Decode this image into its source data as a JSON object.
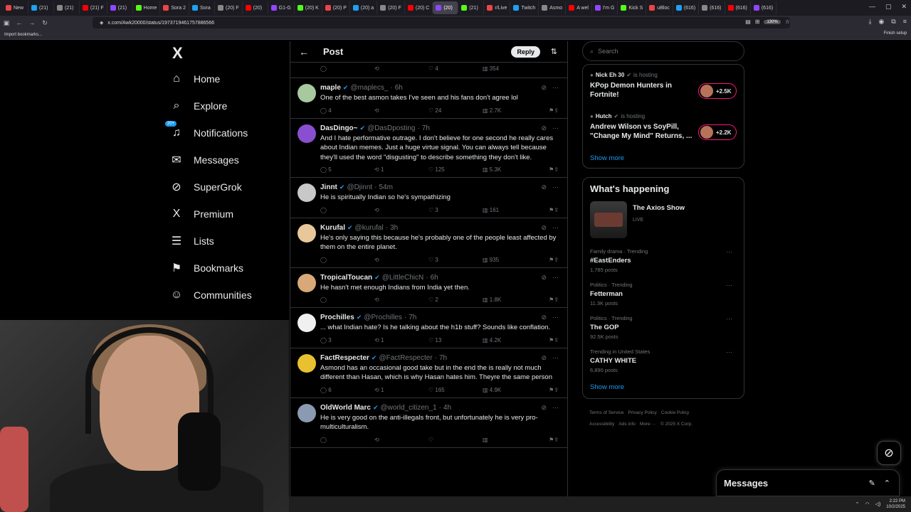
{
  "browser": {
    "tabs": [
      "New",
      "(21)",
      "(21)",
      "(21) F",
      "(21)",
      "Home",
      "Sora 2",
      "Sora",
      "(20) F",
      "(20)",
      "G1-G",
      "(20) K",
      "(20) P",
      "(20) a",
      "(20) F",
      "(20) C",
      "(20)",
      "(21)",
      "r/Live",
      "Twitch",
      "Asmo",
      "A wel",
      "I'm G",
      "Kick S",
      "uBloc",
      "(616)",
      "(616)",
      "(616)",
      "(616)"
    ],
    "active_tab_index": 16,
    "url": "x.com/Awk20000/status/1973719461757886566",
    "zoom": "130%",
    "bookmark": "Import bookmarks...",
    "finish_setup": "Finish setup"
  },
  "nav": {
    "logo": "X",
    "notif_badge": "20+",
    "items": [
      {
        "label": "Home",
        "icon": "home-icon",
        "glyph": "⌂"
      },
      {
        "label": "Explore",
        "icon": "search-icon",
        "glyph": "⌕"
      },
      {
        "label": "Notifications",
        "icon": "bell-icon",
        "glyph": "♫"
      },
      {
        "label": "Messages",
        "icon": "mail-icon",
        "glyph": "✉"
      },
      {
        "label": "SuperGrok",
        "icon": "grok-icon",
        "glyph": "⊘"
      },
      {
        "label": "Premium",
        "icon": "x-premium-icon",
        "glyph": "X"
      },
      {
        "label": "Lists",
        "icon": "list-icon",
        "glyph": "☰"
      },
      {
        "label": "Bookmarks",
        "icon": "bookmark-icon",
        "glyph": "⚑"
      },
      {
        "label": "Communities",
        "icon": "communities-icon",
        "glyph": "☺"
      }
    ]
  },
  "feed": {
    "title": "Post",
    "reply_button": "Reply",
    "prev_actions": {
      "likes": "4",
      "views": "354"
    },
    "tweets": [
      {
        "name": "maple",
        "handle": "@maplecs_",
        "time": "6h",
        "text": "One of the best asmon takes I've seen and his fans don't agree lol",
        "replies": "4",
        "retweets": "",
        "likes": "24",
        "views": "2.7K",
        "avatar_color": "#a8c8a0"
      },
      {
        "name": "DasDingo~",
        "handle": "@DasDposting",
        "time": "7h",
        "text": "And I hate performative outrage. I don't believe for one second he really cares about Indian memes. Just a huge virtue signal. You can always tell because they'll used the word \"disgusting\" to describe something they don't like.",
        "replies": "5",
        "retweets": "1",
        "likes": "125",
        "views": "5.3K",
        "avatar_color": "#8a4fd0"
      },
      {
        "name": "Jinnt",
        "handle": "@Djinnt",
        "time": "54m",
        "text": "He is spiritually Indian so he's sympathizing",
        "replies": "",
        "retweets": "",
        "likes": "3",
        "views": "161",
        "avatar_color": "#c8c8c8"
      },
      {
        "name": "Kurufal",
        "handle": "@kurufal",
        "time": "3h",
        "text": "He's only saying this because he's probably one of the people least affected by them on the entire planet.",
        "replies": "",
        "retweets": "",
        "likes": "3",
        "views": "935",
        "avatar_color": "#e8c89a"
      },
      {
        "name": "TropicalToucan",
        "handle": "@LittleChicN",
        "time": "6h",
        "text": "He hasn't met enough Indians from India yet then.",
        "replies": "",
        "retweets": "",
        "likes": "2",
        "views": "1.8K",
        "avatar_color": "#d8a878"
      },
      {
        "name": "Prochilles",
        "handle": "@Prochilles",
        "time": "7h",
        "text": "... what Indian hate? Is he talking about the h1b stuff? Sounds like conflation.",
        "replies": "3",
        "retweets": "1",
        "likes": "13",
        "views": "4.2K",
        "avatar_color": "#f0f0f0"
      },
      {
        "name": "FactRespecter",
        "handle": "@FactRespecter",
        "time": "7h",
        "text": "Asmond has an occasional good take but in the end the is really not much different than Hasan, which is why Hasan hates him. Theyre the same person",
        "replies": "6",
        "retweets": "1",
        "likes": "165",
        "views": "4.9K",
        "avatar_color": "#e8c030"
      },
      {
        "name": "OldWorld Marc",
        "handle": "@world_citizen_1",
        "time": "4h",
        "text": "He is very good on the anti-illegals front, but unfortunately he is very pro-multiculturalism.",
        "replies": "",
        "retweets": "",
        "likes": "",
        "views": "",
        "avatar_color": "#8a9ab0"
      }
    ]
  },
  "right": {
    "search_placeholder": "Search",
    "spaces": [
      {
        "host": "Nick Eh 30",
        "status": "is hosting",
        "title": "KPop Demon Hunters in Fortnite!",
        "count": "+2.5K"
      },
      {
        "host": "Hutch",
        "status": "is hosting",
        "title": "Andrew Wilson vs SoyPill, \"Change My Mind\" Returns, ...",
        "count": "+2.2K"
      }
    ],
    "show_more": "Show more",
    "happening_title": "What's happening",
    "axios": {
      "name": "The Axios Show",
      "live": "LIVE"
    },
    "trends": [
      {
        "cat": "Family drama · Trending",
        "name": "#EastEnders",
        "count": "1,785 posts"
      },
      {
        "cat": "Politics · Trending",
        "name": "Fetterman",
        "count": "11.3K posts"
      },
      {
        "cat": "Politics · Trending",
        "name": "The GOP",
        "count": "92.5K posts"
      },
      {
        "cat": "Trending in United States",
        "name": "CATHY WHITE",
        "count": "6,890 posts"
      }
    ],
    "show_more2": "Show more",
    "footer": [
      "Terms of Service",
      "Privacy Policy",
      "Cookie Policy",
      "Accessibility",
      "Ads info",
      "More ···",
      "© 2025 X Corp."
    ]
  },
  "messages_bar": "Messages",
  "taskbar": {
    "time": "2:22 PM",
    "date": "10/2/2025"
  }
}
